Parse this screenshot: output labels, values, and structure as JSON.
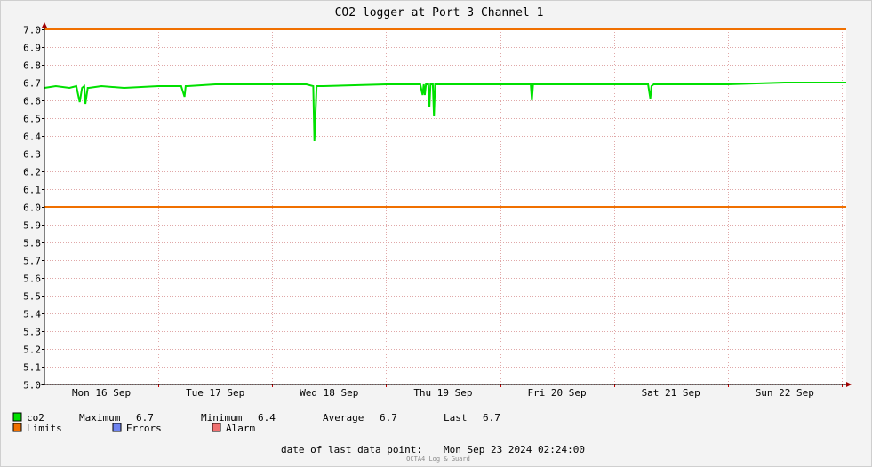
{
  "chart_data": {
    "type": "line",
    "title": "CO2 logger at Port 3 Channel 1",
    "y_ticks": [
      "7.0",
      "6.9",
      "6.8",
      "6.7",
      "6.6",
      "6.5",
      "6.4",
      "6.3",
      "6.2",
      "6.1",
      "6.0",
      "5.9",
      "5.8",
      "5.7",
      "5.6",
      "5.5",
      "5.4",
      "5.3",
      "5.2",
      "5.1",
      "5.0"
    ],
    "ylim": [
      5.0,
      7.0
    ],
    "x_range_days": [
      0,
      7.04
    ],
    "x_ticks": [
      {
        "label": "Mon 16 Sep",
        "day": 0.5
      },
      {
        "label": "Tue 17 Sep",
        "day": 1.5
      },
      {
        "label": "Wed 18 Sep",
        "day": 2.5
      },
      {
        "label": "Thu 19 Sep",
        "day": 3.5
      },
      {
        "label": "Fri 20 Sep",
        "day": 4.5
      },
      {
        "label": "Sat 21 Sep",
        "day": 5.5
      },
      {
        "label": "Sun 22 Sep",
        "day": 6.5
      }
    ],
    "day_boundaries": [
      1,
      2,
      3,
      4,
      5,
      6,
      7
    ],
    "vrule_day": 2.38,
    "limits": [
      6.0,
      7.0
    ],
    "series": [
      {
        "name": "co2",
        "color": "#00e000",
        "x": [
          0,
          0.1,
          0.22,
          0.28,
          0.3,
          0.31,
          0.33,
          0.35,
          0.36,
          0.38,
          0.39,
          0.5,
          0.7,
          1.0,
          1.2,
          1.23,
          1.24,
          1.26,
          1.5,
          2.0,
          2.3,
          2.36,
          2.37,
          2.39,
          2.45,
          3.0,
          3.3,
          3.32,
          3.33,
          3.34,
          3.35,
          3.37,
          3.38,
          3.39,
          3.41,
          3.42,
          3.43,
          3.44,
          3.45,
          3.47,
          3.6,
          4.0,
          4.27,
          4.28,
          4.29,
          4.31,
          4.5,
          5.0,
          5.3,
          5.32,
          5.33,
          5.35,
          5.5,
          6.0,
          6.5,
          7.04
        ],
        "y": [
          6.67,
          6.68,
          6.67,
          6.68,
          6.62,
          6.59,
          6.67,
          6.68,
          6.58,
          6.67,
          6.67,
          6.68,
          6.67,
          6.68,
          6.68,
          6.62,
          6.68,
          6.68,
          6.69,
          6.69,
          6.69,
          6.68,
          6.37,
          6.68,
          6.68,
          6.69,
          6.69,
          6.63,
          6.69,
          6.63,
          6.69,
          6.69,
          6.56,
          6.69,
          6.69,
          6.51,
          6.69,
          6.69,
          6.69,
          6.69,
          6.69,
          6.69,
          6.69,
          6.6,
          6.69,
          6.69,
          6.69,
          6.69,
          6.69,
          6.61,
          6.68,
          6.69,
          6.69,
          6.69,
          6.7,
          6.7
        ]
      }
    ]
  },
  "legend": {
    "row1": {
      "series": "co2",
      "max_label": "Maximum",
      "max_value": "6.7",
      "min_label": "Minimum",
      "min_value": "6.4",
      "avg_label": "Average",
      "avg_value": "6.7",
      "last_label": "Last",
      "last_value": "6.7"
    },
    "row2": {
      "limits": "Limits",
      "errors": "Errors",
      "alarm": "Alarm"
    }
  },
  "colors": {
    "co2": "#00e000",
    "limits": "#f07000",
    "errors": "#6f84f0",
    "alarm": "#f07070",
    "vrule": "#f06060"
  },
  "footer": {
    "last_point_label": "date of last data point:",
    "last_point_value": "Mon Sep 23 2024 02:24:00",
    "credit": "OCTA4 Log & Guard"
  }
}
